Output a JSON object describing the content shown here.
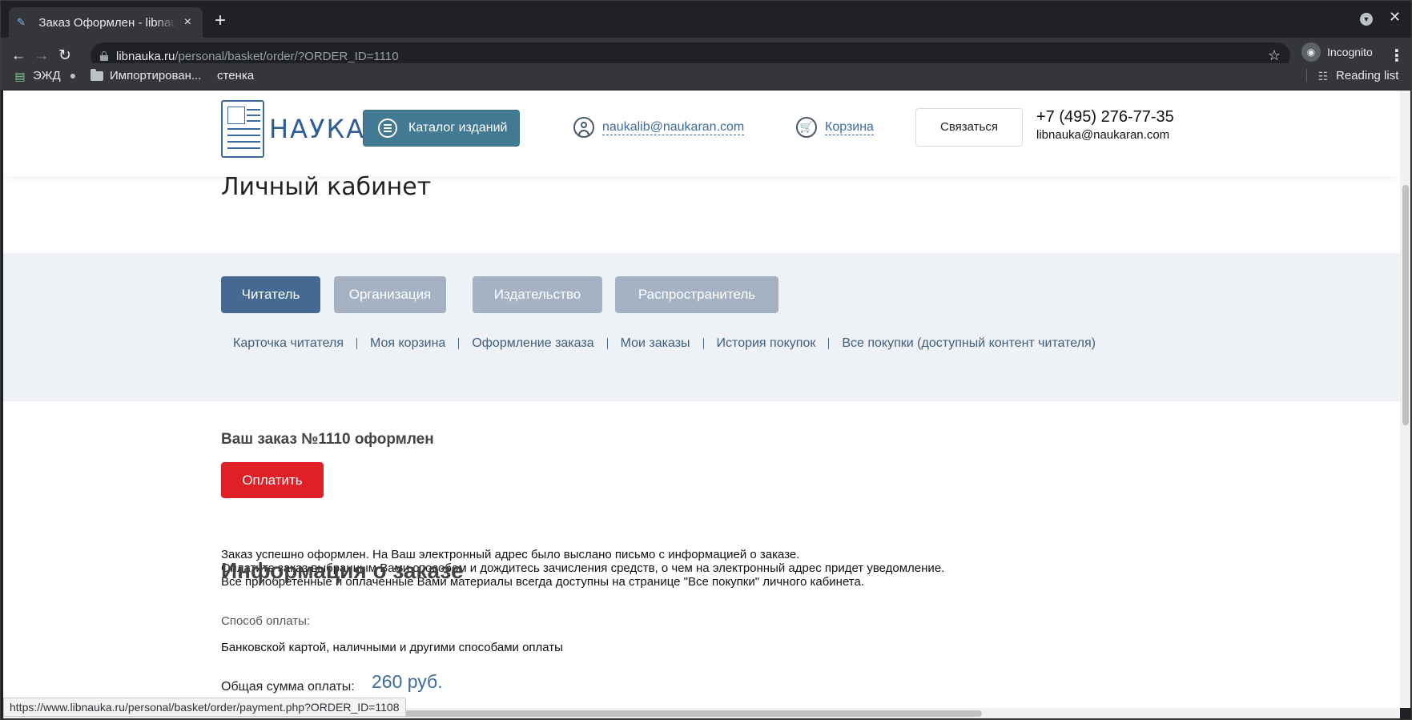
{
  "browser": {
    "tab_title": "Заказ Оформлен - libnauka.ru",
    "tab_close": "×",
    "new_tab": "+",
    "url_host": "libnauka.ru",
    "url_path": "/personal/basket/order/?ORDER_ID=1110",
    "incognito_label": "Incognito",
    "bookmarks": [
      "ЭЖД",
      "Импортирован...",
      "стенка"
    ],
    "reading_list": "Reading list",
    "status_url": "https://www.libnauka.ru/personal/basket/order/payment.php?ORDER_ID=1108"
  },
  "header": {
    "logo_text": "НАУКА",
    "catalog_label": "Каталог изданий",
    "user_email": "naukalib@naukaran.com",
    "cart_label": "Корзина",
    "contact_label": "Связаться",
    "phone": "+7 (495) 276-77-35",
    "email": "libnauka@naukaran.com"
  },
  "page": {
    "title": "Личный кабинет",
    "role_tabs": [
      "Читатель",
      "Организация",
      "Издательство",
      "Распространитель"
    ],
    "active_role": "Читатель",
    "subnav": [
      "Карточка читателя",
      "Моя корзина",
      "Оформление заказа",
      "Мои заказы",
      "История покупок",
      "Все покупки (доступный контент читателя)"
    ]
  },
  "order": {
    "heading": "Ваш заказ №1110 оформлен",
    "pay_button": "Оплатить",
    "messages": [
      "Заказ успешно оформлен. На Ваш электронный адрес было выслано письмо с информацией о заказе.",
      "Оплатите заказ выбранным Вами способом и дождитесь зачисления средств, о чем на электронный адрес придет уведомление.",
      "Все приобретенные и оплаченные Вами материалы всегда доступны на странице \"Все покупки\" личного кабинета."
    ],
    "info_heading": "Информация о заказе",
    "pay_method_label": "Способ оплаты:",
    "pay_method_value": "Банковской картой, наличными и другими способами оплаты",
    "total_label": "Общая сумма оплаты:",
    "total_value": "260 руб."
  },
  "colors": {
    "accent": "#437a93",
    "active_tab": "#446a93",
    "inactive_tab": "#a4b2c4",
    "pay_button": "#df2027",
    "link": "#3d6b9e"
  }
}
